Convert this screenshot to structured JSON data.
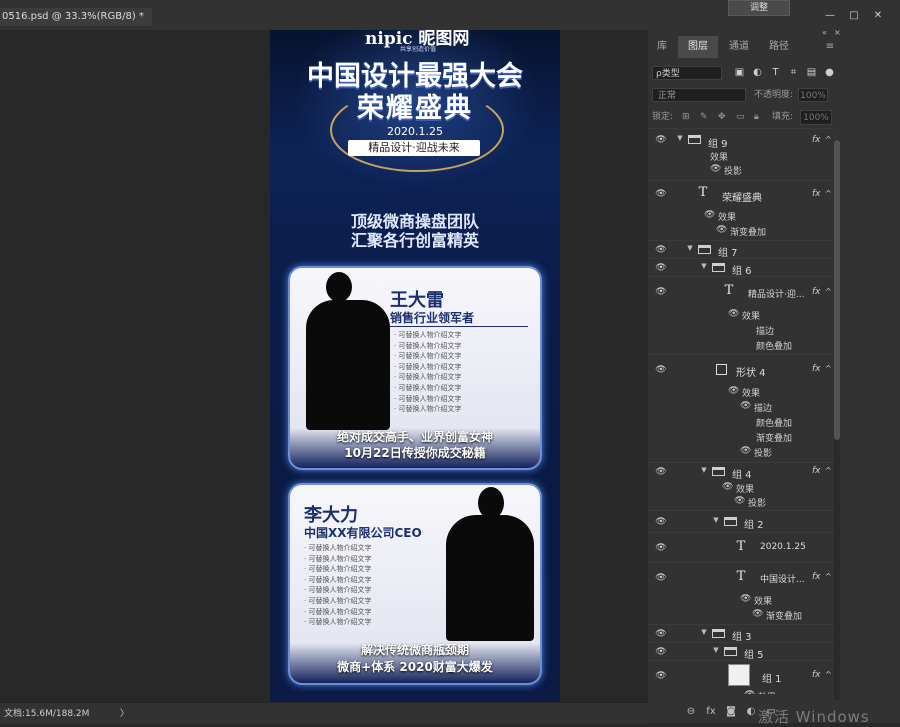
{
  "window": {
    "doc_tab": "0516.psd @ 33.3%(RGB/8) *",
    "adjust_button": "调整",
    "controls": [
      "—",
      "□",
      "✕"
    ]
  },
  "canvas": {
    "logo": "nipic 昵图网",
    "logo_sub": "共享创造价值",
    "title_line1": "中国设计最强大会",
    "title_line2": "荣耀盛典",
    "date": "2020.1.25",
    "slogan": "精品设计·迎战未来",
    "subtitle_line1": "顶级微商操盘团队",
    "subtitle_line2": "汇聚各行创富精英",
    "card1": {
      "name": "王大雷",
      "role": "销售行业领军者",
      "desc": [
        "· 可替换人物介绍文字",
        "· 可替换人物介绍文字",
        "· 可替换人物介绍文字",
        "· 可替换人物介绍文字",
        "· 可替换人物介绍文字",
        "· 可替换人物介绍文字",
        "· 可替换人物介绍文字",
        "· 可替换人物介绍文字"
      ],
      "bottom1": "绝对成交高手、业界创富女神",
      "bottom2": "10月22日传授你成交秘籍"
    },
    "card2": {
      "name": "李大力",
      "role": "中国XX有限公司CEO",
      "desc": [
        "· 可替换人物介绍文字",
        "· 可替换人物介绍文字",
        "· 可替换人物介绍文字",
        "· 可替换人物介绍文字",
        "· 可替换人物介绍文字",
        "· 可替换人物介绍文字",
        "· 可替换人物介绍文字",
        "· 可替换人物介绍文字"
      ],
      "bottom1": "解决传统微商瓶颈期",
      "bottom2": "微商+体系 2020财富大爆发"
    }
  },
  "panel": {
    "tabs": [
      "库",
      "图层",
      "通道",
      "路径"
    ],
    "active_tab": "图层",
    "filter_label": "ρ类型",
    "blend_mode": "正常",
    "opacity_label": "不透明度:",
    "opacity_value": "100%",
    "lock_label": "锁定:",
    "fill_label": "填充:",
    "fill_value": "100%",
    "layers": [
      {
        "name": "组 9"
      },
      {
        "name": "荣耀盛典"
      },
      {
        "name": "组 7"
      },
      {
        "name": "组 6"
      },
      {
        "name": "精品设计·迎..."
      },
      {
        "name": "形状 4"
      },
      {
        "name": "组 4"
      },
      {
        "name": "组 2"
      },
      {
        "name": "2020.1.25"
      },
      {
        "name": "中国设计..."
      },
      {
        "name": "组 3"
      },
      {
        "name": "组 5"
      },
      {
        "name": "组 1"
      }
    ],
    "fx_label": "fx",
    "effects_label": "效果",
    "effect_names": {
      "shadow": "投影",
      "gradient": "渐变叠加",
      "stroke": "描边",
      "color": "颜色叠加"
    }
  },
  "status": {
    "doc_size": "文档:15.6M/188.2M",
    "arrow": "〉"
  },
  "watermark": "激活 Windows"
}
